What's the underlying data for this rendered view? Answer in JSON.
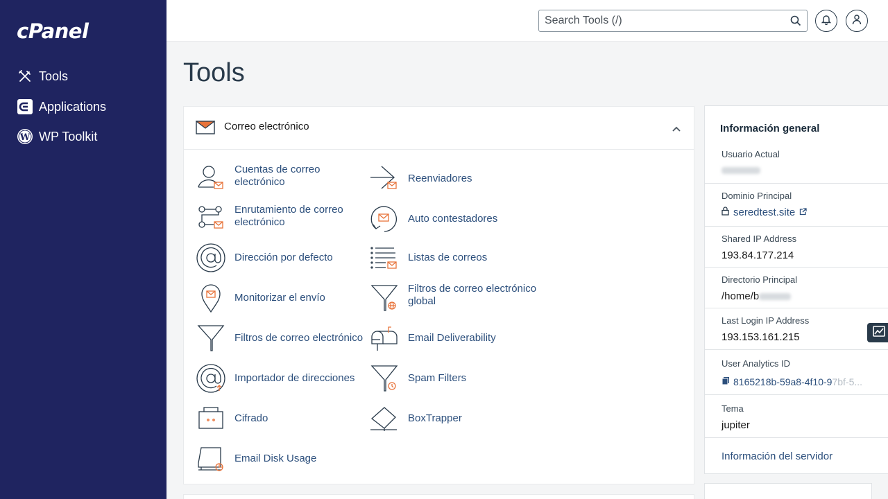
{
  "sidebar": {
    "logo": "cPanel",
    "items": [
      {
        "label": "Tools",
        "icon": "tools-icon"
      },
      {
        "label": "Applications",
        "icon": "applications-icon"
      },
      {
        "label": "WP Toolkit",
        "icon": "wordpress-icon"
      }
    ]
  },
  "header": {
    "search_placeholder": "Search Tools (/)",
    "notifications_icon": "bell-icon",
    "user_icon": "user-icon"
  },
  "page": {
    "title": "Tools"
  },
  "email_section": {
    "title": "Correo electrónico",
    "accent": "#e8733a",
    "tools": [
      {
        "label": "Cuentas de correo electrónico",
        "icon": "email-accounts-icon"
      },
      {
        "label": "Reenviadores",
        "icon": "forwarders-icon"
      },
      {
        "label": "Enrutamiento de correo electrónico",
        "icon": "email-routing-icon"
      },
      {
        "label": "Auto contestadores",
        "icon": "autoresponders-icon"
      },
      {
        "label": "Dirección por defecto",
        "icon": "default-address-icon"
      },
      {
        "label": "Listas de correos",
        "icon": "mailing-lists-icon"
      },
      {
        "label": "Monitorizar el envío",
        "icon": "track-delivery-icon"
      },
      {
        "label": "Filtros de correo electrónico global",
        "icon": "global-email-filters-icon"
      },
      {
        "label": "Filtros de correo electrónico",
        "icon": "email-filters-icon"
      },
      {
        "label": "Email Deliverability",
        "icon": "email-deliverability-icon"
      },
      {
        "label": "Importador de direcciones",
        "icon": "address-importer-icon"
      },
      {
        "label": "Spam Filters",
        "icon": "spam-filters-icon"
      },
      {
        "label": "Cifrado",
        "icon": "encryption-icon"
      },
      {
        "label": "BoxTrapper",
        "icon": "boxtrapper-icon"
      },
      {
        "label": "Email Disk Usage",
        "icon": "email-disk-usage-icon"
      }
    ]
  },
  "general_info": {
    "title": "Información general",
    "current_user_label": "Usuario Actual",
    "primary_domain_label": "Dominio Principal",
    "primary_domain": "seredtest.site",
    "shared_ip_label": "Shared IP Address",
    "shared_ip": "193.84.177.214",
    "home_dir_label": "Directorio Principal",
    "home_dir": "/home/b",
    "last_login_label": "Last Login IP Address",
    "last_login_ip": "193.153.161.215",
    "analytics_label": "User Analytics ID",
    "analytics_id": "8165218b-59a8-4f10-9",
    "analytics_id_faded": "7bf-5...",
    "theme_label": "Tema",
    "theme": "jupiter",
    "server_info_link": "Información del servidor"
  }
}
